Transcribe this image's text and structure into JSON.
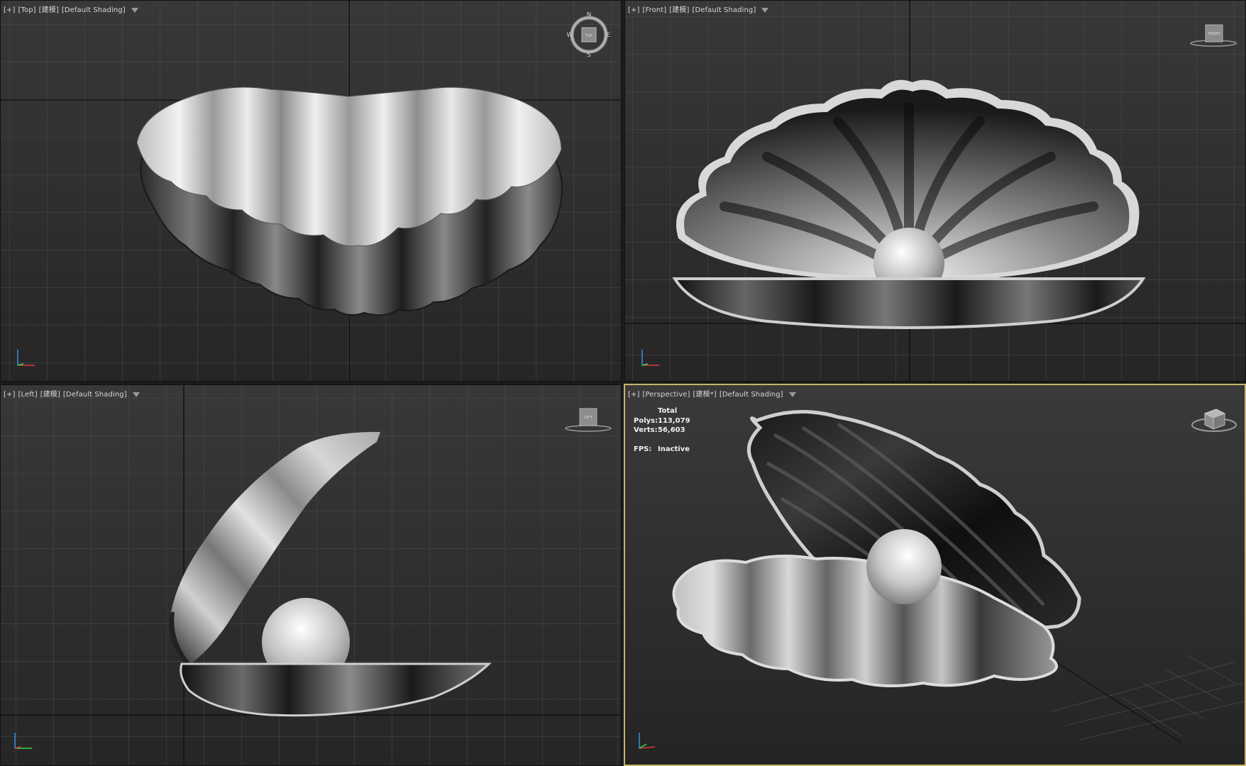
{
  "viewports": {
    "top": {
      "plus": "[+]",
      "view": "[Top]",
      "mode": "[建模]",
      "shading": "[Default Shading]"
    },
    "front": {
      "plus": "[+]",
      "view": "[Front]",
      "mode": "[建模]",
      "shading": "[Default Shading]"
    },
    "left": {
      "plus": "[+]",
      "view": "[Left]",
      "mode": "[建模]",
      "shading": "[Default Shading]"
    },
    "perspective": {
      "plus": "[+]",
      "view": "[Perspective]",
      "mode": "[建模*]",
      "shading": "[Default Shading]",
      "stats": {
        "header": "Total",
        "polys_label": "Polys:",
        "polys": "113,079",
        "verts_label": "Verts:",
        "verts": "56,603",
        "fps_label": "FPS:",
        "fps": "Inactive"
      }
    }
  },
  "compass": {
    "n": "N",
    "s": "S",
    "e": "E",
    "w": "W",
    "cube_label": "TOP"
  },
  "viewcube_labels": {
    "front": "FRONT",
    "left": "LEFT"
  },
  "colors": {
    "active_border": "#c8b36c",
    "viewport_bg": "#2f2f2f",
    "grid": "#4a4a4a",
    "axis_dark": "#111111"
  },
  "icons": [
    "filter-icon",
    "compass-icon",
    "viewcube-icon",
    "axis-tripod-icon"
  ]
}
